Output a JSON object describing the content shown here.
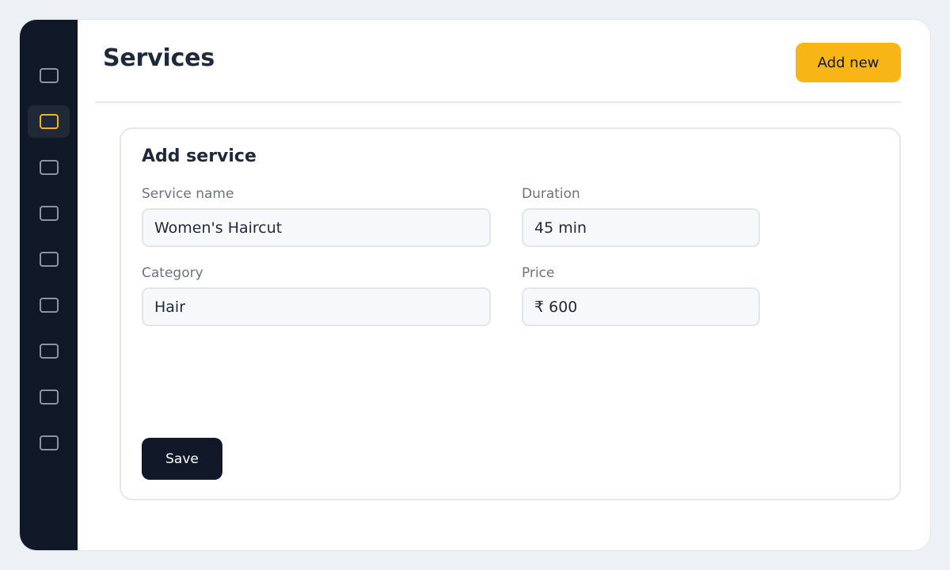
{
  "sidebar": {
    "items": [
      {
        "icon": "nav-icon",
        "active": false
      },
      {
        "icon": "nav-icon",
        "active": true
      },
      {
        "icon": "nav-icon",
        "active": false
      },
      {
        "icon": "nav-icon",
        "active": false
      },
      {
        "icon": "nav-icon",
        "active": false
      },
      {
        "icon": "nav-icon",
        "active": false
      },
      {
        "icon": "nav-icon",
        "active": false
      },
      {
        "icon": "nav-icon",
        "active": false
      },
      {
        "icon": "nav-icon",
        "active": false
      }
    ]
  },
  "header": {
    "title": "Services",
    "add_new_label": "Add new"
  },
  "form": {
    "title": "Add service",
    "service_name": {
      "label": "Service name",
      "value": "Women's Haircut"
    },
    "duration": {
      "label": "Duration",
      "value": "45 min"
    },
    "category": {
      "label": "Category",
      "value": "Hair"
    },
    "price": {
      "label": "Price",
      "value": "₹ 600"
    },
    "save_label": "Save"
  },
  "colors": {
    "accent": "#f8b516",
    "sidebar_bg": "#111827",
    "active_nav": "#1f2937",
    "text_dark": "#1e293b",
    "label_gray": "#6b7280"
  }
}
